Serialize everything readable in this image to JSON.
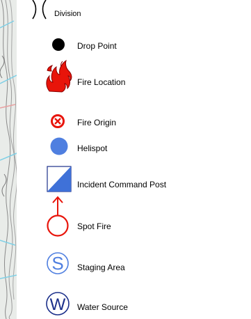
{
  "legend": {
    "items": [
      {
        "label": "Division",
        "icon": "division-parens-icon"
      },
      {
        "label": "Drop Point",
        "icon": "drop-point-dot-icon"
      },
      {
        "label": "Fire Location",
        "icon": "fire-flame-icon"
      },
      {
        "label": "Fire Origin",
        "icon": "fire-origin-circle-x-icon"
      },
      {
        "label": "Helispot",
        "icon": "helispot-dot-icon"
      },
      {
        "label": "Incident Command Post",
        "icon": "icp-square-icon"
      },
      {
        "label": "Spot Fire",
        "icon": "spot-fire-arrow-circle-icon"
      },
      {
        "label": "Staging Area",
        "icon": "staging-area-s-circle-icon"
      },
      {
        "label": "Water Source",
        "icon": "water-source-w-circle-icon"
      }
    ],
    "glyphs": {
      "staging": "S",
      "water": "W"
    }
  },
  "colors": {
    "black": "#000000",
    "red": "#e8140a",
    "fire_dark": "#cc0000",
    "blue": "#4f7fe0",
    "icp_blue": "#3f71d8",
    "navy": "#1b2f8a",
    "map_bg": "#e9ece9",
    "map_blue": "#7fd0e6",
    "map_contour": "#8a8a8a"
  }
}
